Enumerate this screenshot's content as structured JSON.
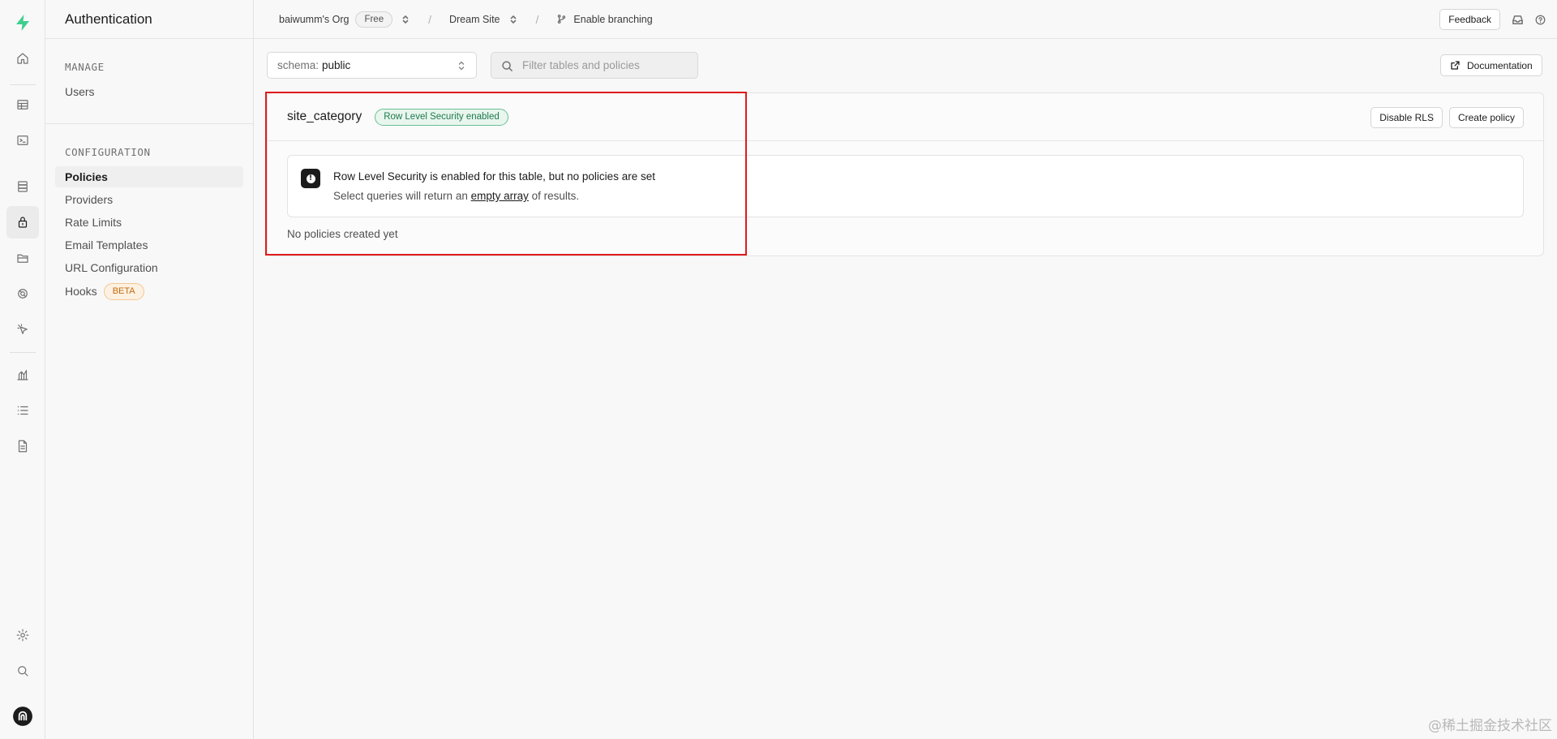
{
  "rail": {
    "items": [
      {
        "name": "home-icon"
      },
      {
        "name": "table-editor-icon"
      },
      {
        "name": "sql-editor-icon"
      },
      {
        "name": "database-icon"
      },
      {
        "name": "authentication-icon",
        "active": true
      },
      {
        "name": "storage-icon"
      },
      {
        "name": "realtime-icon"
      },
      {
        "name": "edge-functions-icon"
      },
      {
        "name": "reports-icon"
      },
      {
        "name": "logs-icon"
      },
      {
        "name": "api-docs-icon"
      },
      {
        "name": "settings-icon"
      },
      {
        "name": "search-icon"
      },
      {
        "name": "user-avatar-icon"
      }
    ]
  },
  "menu": {
    "title": "Authentication",
    "manage_title": "MANAGE",
    "manage_items": [
      {
        "label": "Users"
      }
    ],
    "config_title": "CONFIGURATION",
    "config_items": [
      {
        "label": "Policies",
        "active": true
      },
      {
        "label": "Providers"
      },
      {
        "label": "Rate Limits"
      },
      {
        "label": "Email Templates"
      },
      {
        "label": "URL Configuration"
      },
      {
        "label": "Hooks",
        "badge": "BETA"
      }
    ]
  },
  "topbar": {
    "org": "baiwumm's Org",
    "plan": "Free",
    "separator": "/",
    "project": "Dream Site",
    "branching": "Enable branching",
    "feedback": "Feedback"
  },
  "toolbar": {
    "schema_label": "schema:",
    "schema_value": "public",
    "filter_placeholder": "Filter tables and policies",
    "documentation": "Documentation"
  },
  "table": {
    "name": "site_category",
    "rls_badge": "Row Level Security enabled",
    "disable_rls": "Disable RLS",
    "create_policy": "Create policy",
    "notice_title": "Row Level Security is enabled for this table, but no policies are set",
    "notice_desc_before": "Select queries will return an",
    "notice_desc_link": "empty array",
    "notice_desc_after": "of results.",
    "empty_text": "No policies created yet"
  },
  "watermark": "@稀土掘金技术社区"
}
